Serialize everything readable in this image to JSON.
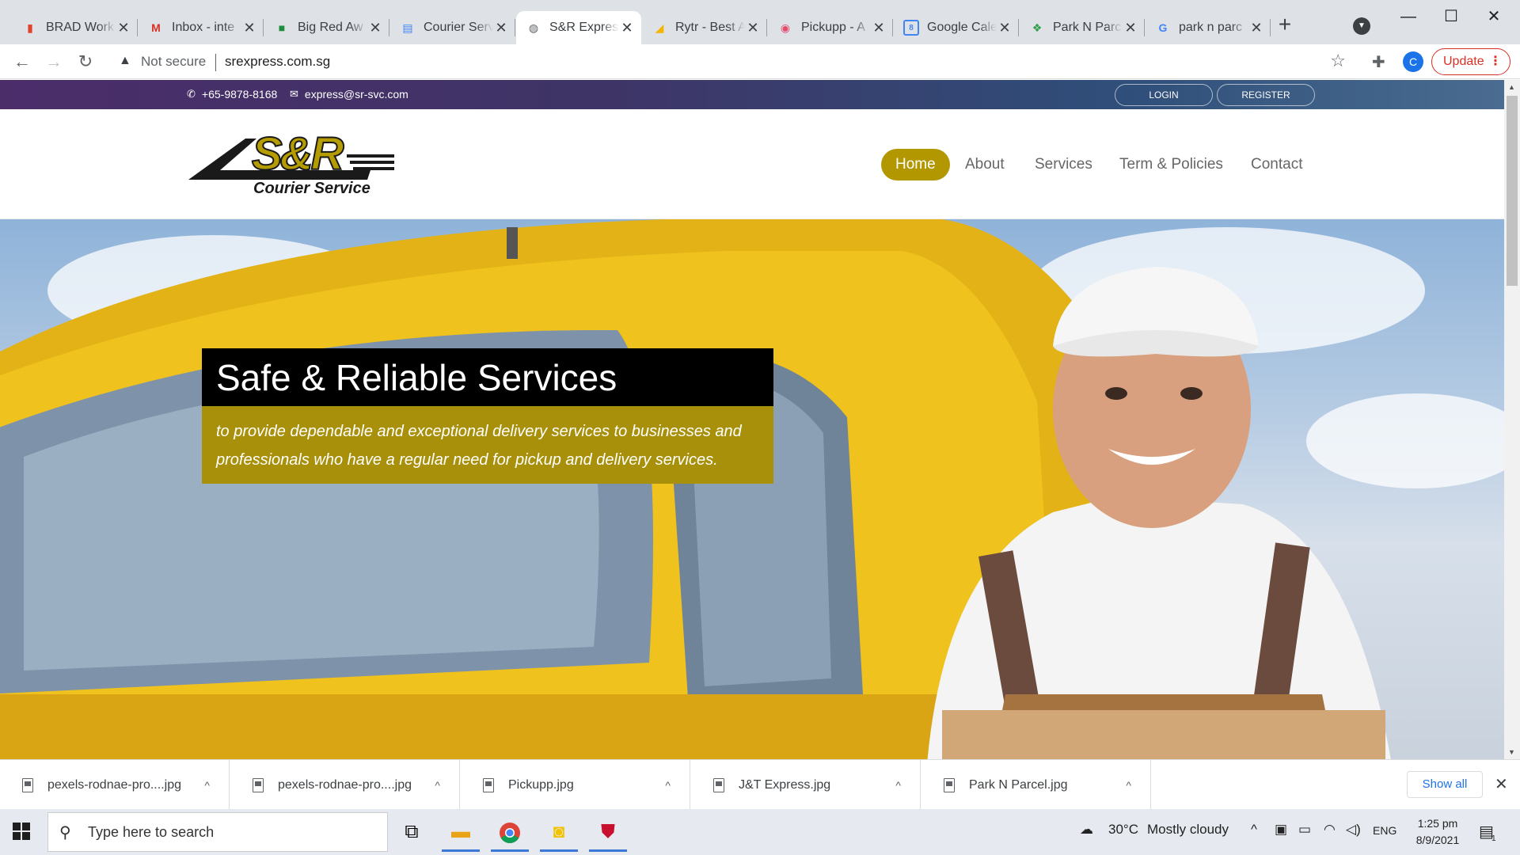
{
  "browser": {
    "tabs": [
      {
        "label": "BRAD Work",
        "icon": "trello-icon",
        "color": "#e2412d"
      },
      {
        "label": "Inbox - inte",
        "icon": "gmail-icon",
        "color": "#d93025"
      },
      {
        "label": "Big Red Aw",
        "icon": "chat-icon",
        "color": "#1e8e3e"
      },
      {
        "label": "Courier Serv",
        "icon": "docs-icon",
        "color": "#4285f4"
      },
      {
        "label": "S&R Expres",
        "icon": "globe-icon",
        "color": "#5f6368"
      },
      {
        "label": "Rytr - Best A",
        "icon": "rytr-icon",
        "color": "#f4b400"
      },
      {
        "label": "Pickupp - A",
        "icon": "pickupp-icon",
        "color": "#e84b6a"
      },
      {
        "label": "Google Cale",
        "icon": "calendar-icon",
        "color": "#4285f4"
      },
      {
        "label": "Park N Parc",
        "icon": "parknparcel-icon",
        "color": "#2e9e4f"
      },
      {
        "label": "park n parc",
        "icon": "google-icon",
        "color": "#4285f4"
      }
    ],
    "active_tab_index": 4,
    "address": {
      "security_label": "Not secure",
      "url": "srexpress.com.sg"
    },
    "profile_initial": "C",
    "update_label": "Update"
  },
  "site": {
    "phone": "+65-9878-8168",
    "email": "express@sr-svc.com",
    "login_label": "LOGIN",
    "register_label": "REGISTER",
    "logo": {
      "mark": "S&R",
      "tagline": "Courier Service"
    },
    "nav": [
      {
        "label": "Home",
        "active": true
      },
      {
        "label": "About",
        "active": false
      },
      {
        "label": "Services",
        "active": false
      },
      {
        "label": "Term & Policies",
        "active": false
      },
      {
        "label": "Contact",
        "active": false
      }
    ],
    "hero": {
      "title": "Safe & Reliable Services",
      "subtitle": "to provide dependable and exceptional delivery services to businesses and professionals who have a regular need for pickup and delivery services."
    },
    "accent_color": "#b39700"
  },
  "downloads": {
    "items": [
      {
        "name": "pexels-rodnae-pro....jpg"
      },
      {
        "name": "pexels-rodnae-pro....jpg"
      },
      {
        "name": "Pickupp.jpg"
      },
      {
        "name": "J&T Express.jpg"
      },
      {
        "name": "Park N Parcel.jpg"
      }
    ],
    "show_all_label": "Show all"
  },
  "taskbar": {
    "search_placeholder": "Type here to search",
    "weather_temp": "30°C",
    "weather_desc": "Mostly cloudy",
    "language": "ENG",
    "time": "1:25 pm",
    "date": "8/9/2021",
    "notification_count": "1"
  }
}
